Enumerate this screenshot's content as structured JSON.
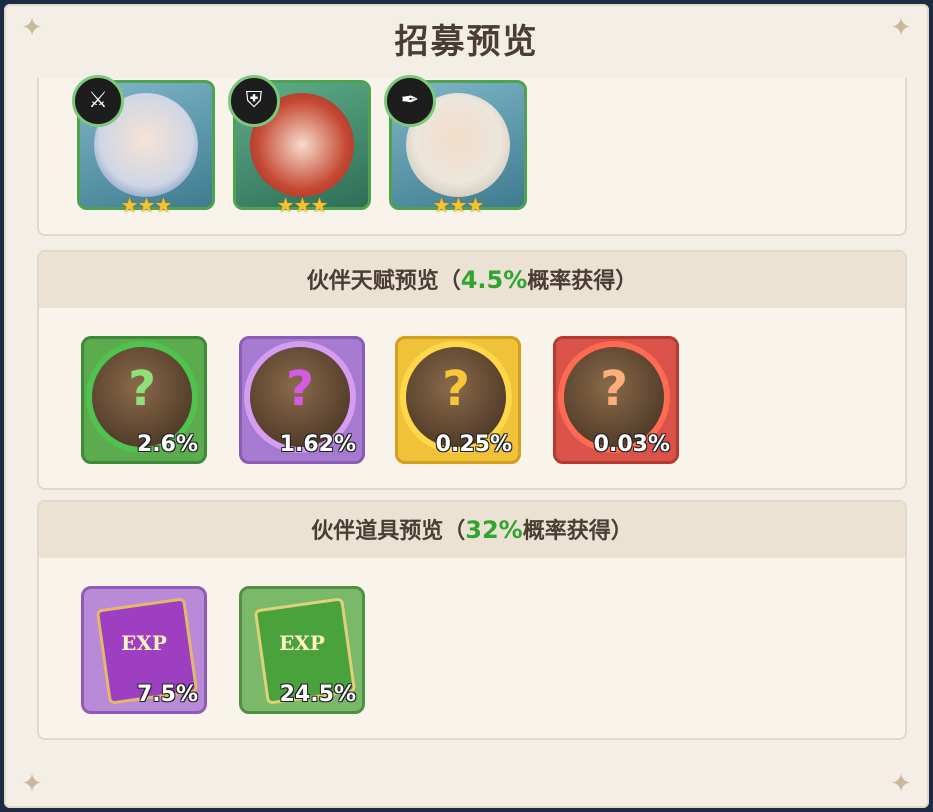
{
  "title": "招募预览",
  "heroes": [
    {
      "name": "hero-1",
      "icon": "sword-icon",
      "stars": "★★★",
      "glyph": "⚔"
    },
    {
      "name": "hero-2",
      "icon": "shield-icon",
      "stars": "★★★",
      "glyph": "⛨"
    },
    {
      "name": "hero-3",
      "icon": "feather-icon",
      "stars": "★★★",
      "glyph": "✒"
    }
  ],
  "talent": {
    "label_prefix": "伙伴天赋预览（",
    "pct": "4.5%",
    "label_suffix": "概率获得）",
    "q_mark": "?",
    "cards": [
      {
        "rate": "2.6%",
        "color": "#5cab4e"
      },
      {
        "rate": "1.62%",
        "color": "#a57ad0"
      },
      {
        "rate": "0.25%",
        "color": "#f0c23a"
      },
      {
        "rate": "0.03%",
        "color": "#d9534a"
      }
    ]
  },
  "items": {
    "label_prefix": "伙伴道具预览（",
    "pct": "32%",
    "label_suffix": "概率获得）",
    "books": [
      {
        "label": "EXP",
        "rate": "7.5%",
        "color": "#9e62c8"
      },
      {
        "label": "EXP",
        "rate": "24.5%",
        "color": "#5da84a"
      }
    ]
  }
}
